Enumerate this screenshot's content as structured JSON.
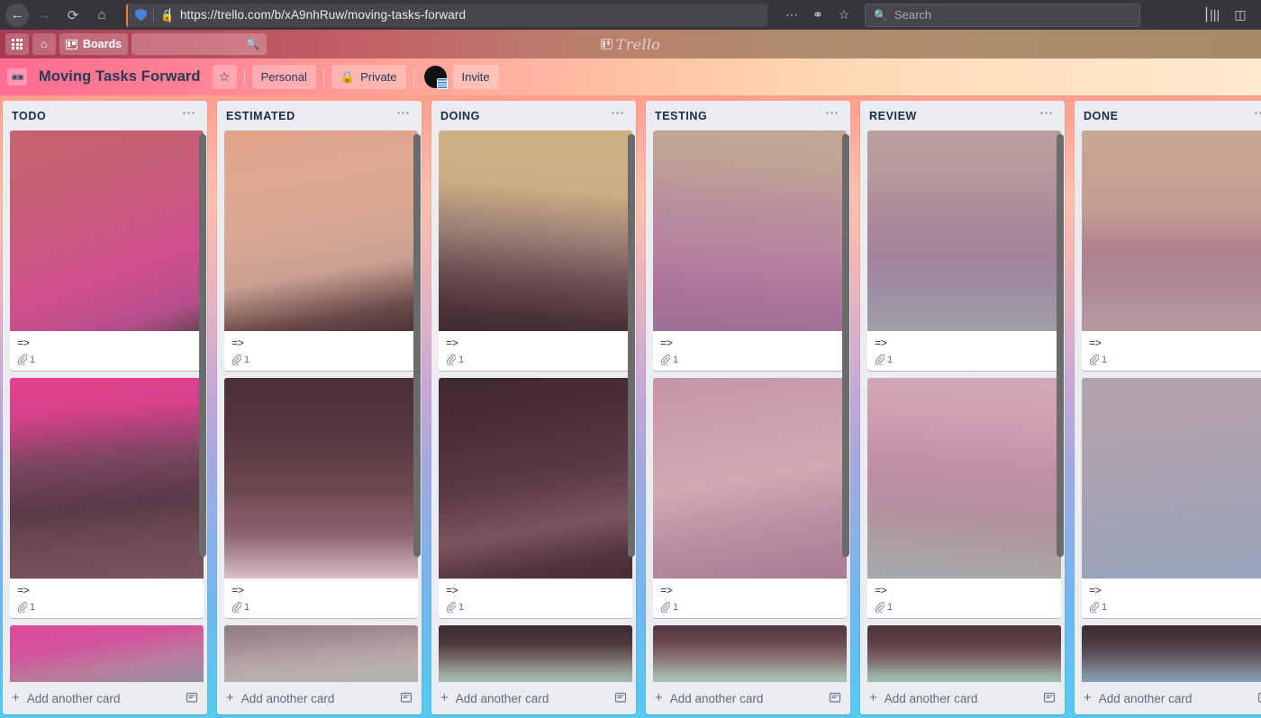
{
  "browser": {
    "back_icon": "back-arrow",
    "forward_icon": "forward-arrow",
    "reload_icon": "reload",
    "home_icon": "home",
    "url": "https://trello.com/b/xA9nhRuw/moving-tasks-forward",
    "lock_icon": "lock",
    "shield_icon": "shield",
    "menu_icon": "ellipsis",
    "pocket_icon": "pocket",
    "bookmark_icon": "star",
    "search_placeholder": "Search",
    "search_icon": "search-icon",
    "library_icon": "library",
    "sidebar_icon": "sidebar"
  },
  "top_nav": {
    "apps_label": "apps-grid",
    "home_label": "home",
    "boards_label": "Boards",
    "search_value": "",
    "logo_text": "Trello"
  },
  "board_header": {
    "title": "Moving Tasks Forward",
    "star_icon": "star-icon",
    "team_label": "Personal",
    "visibility_label": "Private",
    "visibility_icon": "lock-icon",
    "invite_label": "Invite",
    "avatar_label": "user-avatar",
    "board_icon": "board-icon"
  },
  "footer": {
    "add_card_label": "Add another card",
    "template_icon": "template-icon",
    "plus_icon": "plus-icon"
  },
  "card": {
    "title": "=>",
    "attachment_count": "1",
    "attachment_icon": "paperclip-icon"
  },
  "lists": [
    {
      "name": "TODO",
      "menu_icon": "ellipsis-icon",
      "accent": "#e0449a",
      "cards": [
        {
          "title": "=>",
          "attachments": "1",
          "cover": "cv-1"
        },
        {
          "title": "=>",
          "attachments": "1",
          "cover": "cv-2"
        },
        {
          "title": "",
          "attachments": "",
          "cover": "cv-3"
        }
      ]
    },
    {
      "name": "ESTIMATED",
      "menu_icon": "ellipsis-icon",
      "accent": "#ff8f8a",
      "cards": [
        {
          "title": "=>",
          "attachments": "1",
          "cover": "cv-4"
        },
        {
          "title": "=>",
          "attachments": "1",
          "cover": "cv-5"
        },
        {
          "title": "",
          "attachments": "",
          "cover": "cv-6"
        }
      ]
    },
    {
      "name": "DOING",
      "menu_icon": "ellipsis-icon",
      "accent": "#ff9d8c",
      "cards": [
        {
          "title": "=>",
          "attachments": "1",
          "cover": "cv-7"
        },
        {
          "title": "=>",
          "attachments": "1",
          "cover": "cv-8"
        },
        {
          "title": "",
          "attachments": "",
          "cover": "cv-9"
        }
      ]
    },
    {
      "name": "TESTING",
      "menu_icon": "ellipsis-icon",
      "accent": "#ffcb8a",
      "cards": [
        {
          "title": "=>",
          "attachments": "1",
          "cover": "cv-10"
        },
        {
          "title": "=>",
          "attachments": "1",
          "cover": "cv-11"
        },
        {
          "title": "",
          "attachments": "",
          "cover": "cv-12"
        }
      ]
    },
    {
      "name": "REVIEW",
      "menu_icon": "ellipsis-icon",
      "accent": "#ffd9a0",
      "cards": [
        {
          "title": "=>",
          "attachments": "1",
          "cover": "cv-13"
        },
        {
          "title": "=>",
          "attachments": "1",
          "cover": "cv-14"
        },
        {
          "title": "",
          "attachments": "",
          "cover": "cv-15"
        }
      ]
    },
    {
      "name": "DONE",
      "menu_icon": "ellipsis-icon",
      "accent": "#ffe0b0",
      "cards": [
        {
          "title": "=>",
          "attachments": "1",
          "cover": "cv-16"
        },
        {
          "title": "=>",
          "attachments": "1",
          "cover": "cv-17"
        },
        {
          "title": "",
          "attachments": "",
          "cover": "cv-18"
        }
      ]
    }
  ]
}
